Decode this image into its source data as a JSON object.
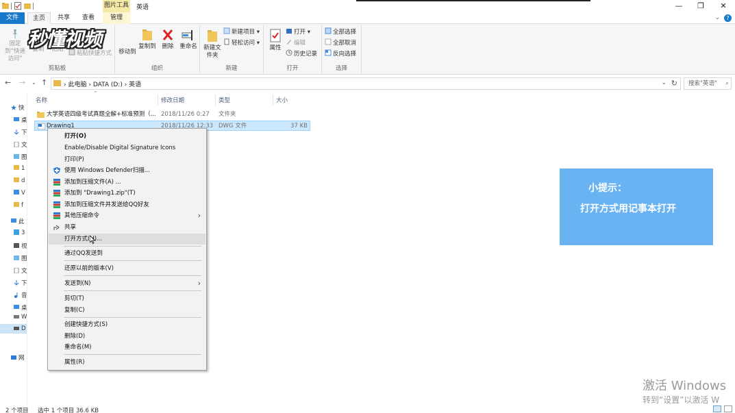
{
  "window": {
    "title": "英语",
    "contextual_tab": "图片工具",
    "controls": {
      "minimize": "—",
      "maximize": "❐",
      "close": "✕"
    }
  },
  "ribbon_tabs": {
    "file": "文件",
    "home": "主页",
    "share": "共享",
    "view": "查看",
    "manage": "管理"
  },
  "ribbon": {
    "clipboard": {
      "caption": "剪贴板",
      "pin": "固定到“快速访问”",
      "copy": "复制",
      "paste": "粘贴",
      "cut": "剪切",
      "paste_shortcut": "粘贴快捷方式"
    },
    "organize": {
      "caption": "组织",
      "move_to": "移动到",
      "copy_to": "复制到",
      "delete": "删除",
      "rename": "重命名"
    },
    "new": {
      "caption": "新建",
      "new_folder": "新建文件夹",
      "new_item": "新建项目",
      "easy_access": "轻松访问"
    },
    "open": {
      "caption": "打开",
      "properties": "属性",
      "open": "打开",
      "edit": "编辑",
      "history": "历史记录"
    },
    "select": {
      "caption": "选择",
      "select_all": "全部选择",
      "select_none": "全部取消",
      "invert": "反向选择"
    }
  },
  "watermark_logo": "秒懂视频",
  "address": {
    "path": [
      "此电脑",
      "DATA (D:)",
      "英语"
    ],
    "search_placeholder": "搜索\"英语\""
  },
  "nav_pane": {
    "items": [
      "快",
      "桌",
      "下",
      "文",
      "图",
      "1",
      "d",
      "V",
      "f",
      "此",
      "3",
      "视",
      "图",
      "文",
      "下",
      "音",
      "桌",
      "W",
      "D",
      "网"
    ]
  },
  "file_list": {
    "columns": {
      "name": "名称",
      "modified": "修改日期",
      "type": "类型",
      "size": "大小"
    },
    "rows": [
      {
        "name": "大学英语四级考试真题全解+标准预测（...",
        "modified": "2018/11/26 0:27",
        "type": "文件夹",
        "size": ""
      },
      {
        "name": "Drawing1",
        "modified": "2018/11/26 12:33",
        "type": "DWG 文件",
        "size": "37 KB"
      }
    ]
  },
  "context_menu": {
    "items": [
      {
        "label": "打开(O)"
      },
      {
        "label": "Enable/Disable Digital Signature Icons"
      },
      {
        "label": "打印(P)"
      },
      {
        "label": "使用 Windows Defender扫描..."
      },
      {
        "label": "添加到压缩文件(A) ..."
      },
      {
        "label": "添加到 \"Drawing1.zip\"(T)"
      },
      {
        "label": "添加到压缩文件并发送给QQ好友"
      },
      {
        "label": "其他压缩命令"
      },
      {
        "label": "共享"
      },
      {
        "label": "打开方式(H)..."
      },
      {
        "label": "通过QQ发送到"
      },
      {
        "label": "还原以前的版本(V)"
      },
      {
        "label": "发送到(N)"
      },
      {
        "label": "剪切(T)"
      },
      {
        "label": "复制(C)"
      },
      {
        "label": "创建快捷方式(S)"
      },
      {
        "label": "删除(D)"
      },
      {
        "label": "重命名(M)"
      },
      {
        "label": "属性(R)"
      }
    ]
  },
  "tip": {
    "title": "小提示：",
    "text": "打开方式用记事本打开"
  },
  "activation": {
    "line1": "激活 Windows",
    "line2": "转到“设置”以激活 W"
  },
  "status": {
    "count": "2 个项目",
    "selection": "选中 1 个项目  36.6 KB"
  },
  "colors": {
    "file_tab": "#1979ca",
    "selection": "#cce8ff",
    "tip_background": "#6ab3f3",
    "folder": "#e8b94a"
  }
}
